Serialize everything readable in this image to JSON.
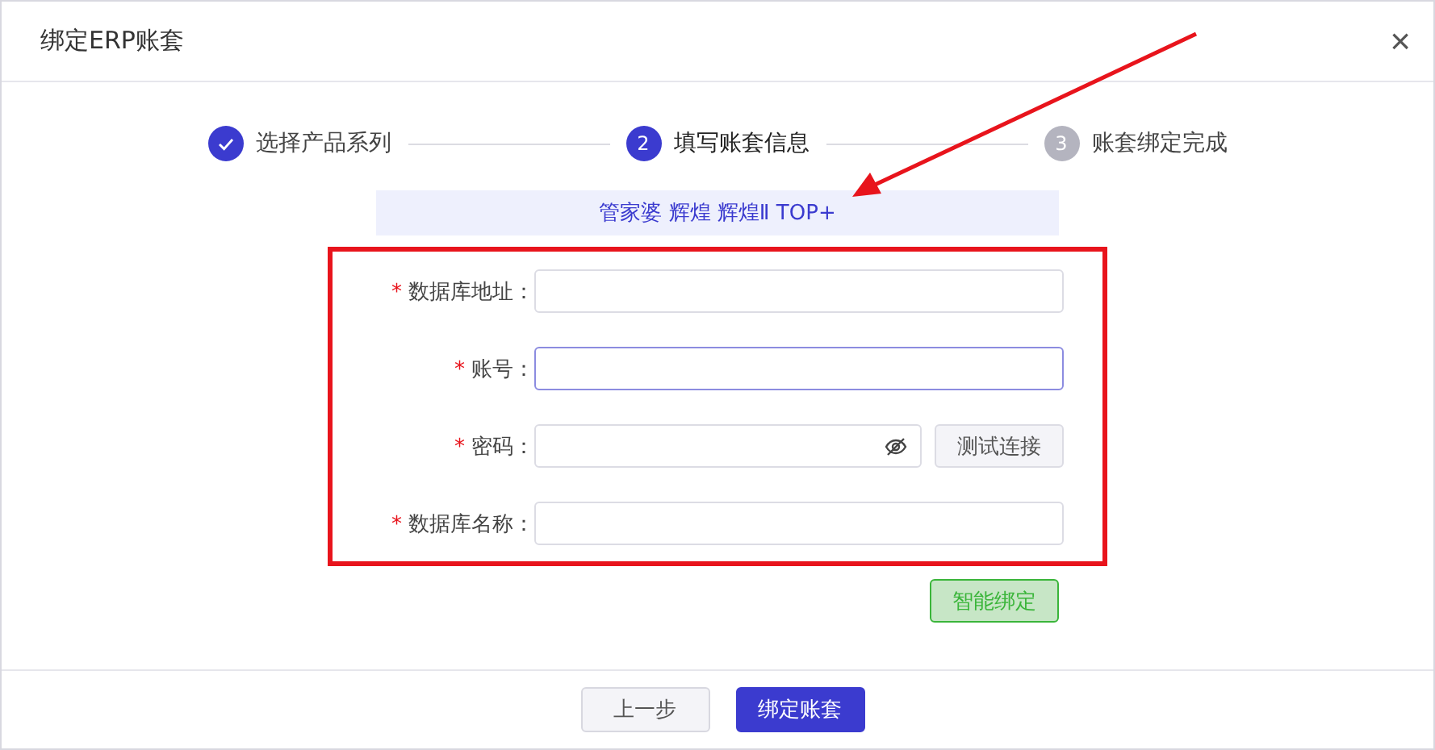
{
  "dialog": {
    "title": "绑定ERP账套",
    "close": "×"
  },
  "steps": [
    {
      "label": "选择产品系列",
      "completed": true,
      "selected": false
    },
    {
      "number": "2",
      "label": "填写账套信息",
      "completed": false,
      "selected": true
    },
    {
      "number": "3",
      "label": "账套绑定完成",
      "completed": false,
      "selected": false
    }
  ],
  "banner": "管家婆 辉煌 辉煌Ⅱ TOP+",
  "fields": [
    {
      "required_mark": "*",
      "label": "数据库地址：",
      "kind": "text",
      "focused": false
    },
    {
      "required_mark": "*",
      "label": "账号：",
      "kind": "text",
      "focused": true
    },
    {
      "required_mark": "*",
      "label": "密码：",
      "kind": "password",
      "focused": false,
      "action": "测试连接"
    },
    {
      "required_mark": "*",
      "label": "数据库名称：",
      "kind": "text",
      "focused": false
    }
  ],
  "smart_button": "智能绑定",
  "buttons": [
    {
      "label": "上一步",
      "kind": "secondary"
    },
    {
      "label": "绑定账套",
      "kind": "primary"
    }
  ]
}
